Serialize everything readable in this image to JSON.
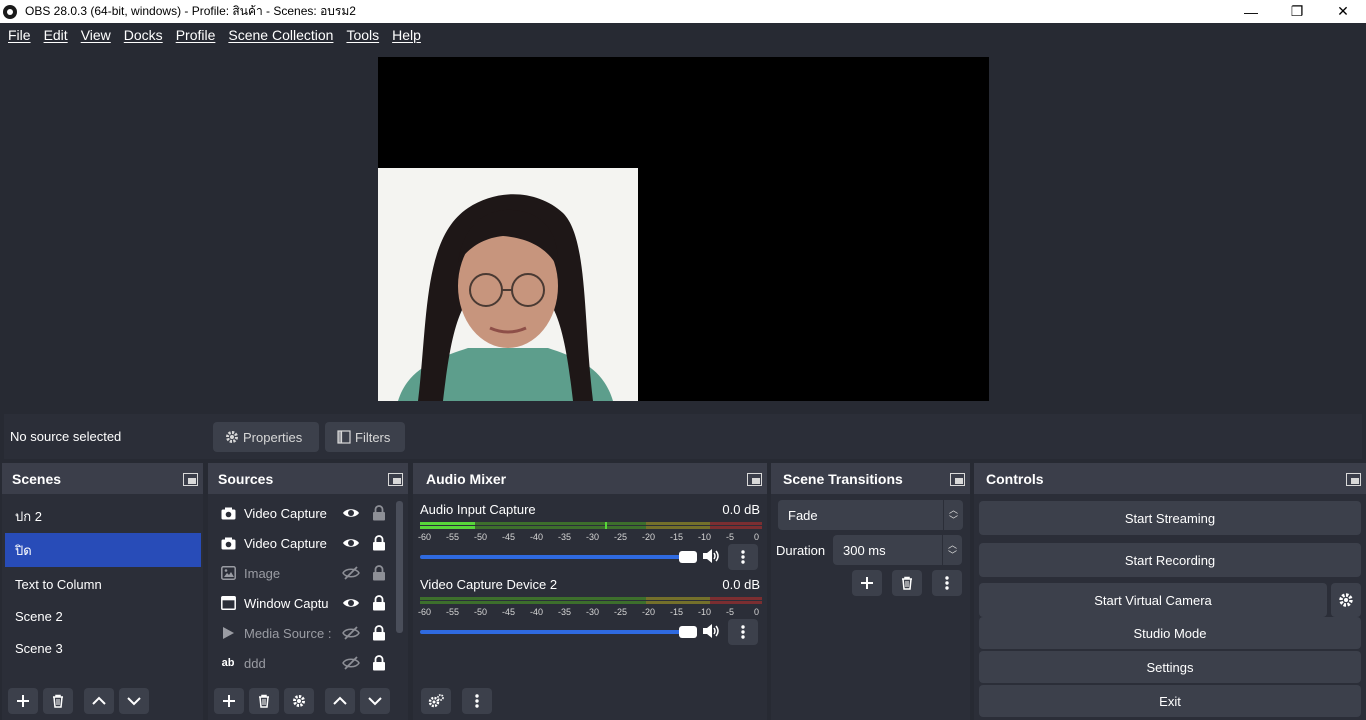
{
  "window": {
    "title": "OBS 28.0.3 (64-bit, windows) - Profile: สินค้า - Scenes: อบรม2",
    "minimize": "—",
    "maximize": "❐",
    "close": "✕"
  },
  "menu": [
    "File",
    "Edit",
    "View",
    "Docks",
    "Profile",
    "Scene Collection",
    "Tools",
    "Help"
  ],
  "source_bar": {
    "no_source": "No source selected",
    "properties": "Properties",
    "filters": "Filters"
  },
  "scenes": {
    "title": "Scenes",
    "items": [
      "ปก 2",
      "ปิด",
      "Text to Column",
      "Scene 2",
      "Scene 3"
    ],
    "selected": "ปิด"
  },
  "sources": {
    "title": "Sources",
    "items": [
      {
        "label": "Video Capture",
        "icon": "camera-icon",
        "visible": true,
        "locked": false
      },
      {
        "label": "Video Capture",
        "icon": "camera-icon",
        "visible": true,
        "locked": true
      },
      {
        "label": "Image",
        "icon": "image-icon",
        "visible": false,
        "locked": false
      },
      {
        "label": "Window Captu",
        "icon": "window-icon",
        "visible": true,
        "locked": true
      },
      {
        "label": "Media Source :",
        "icon": "play-icon",
        "visible": false,
        "locked": true
      },
      {
        "label": "ddd",
        "icon": "text-icon",
        "visible": false,
        "locked": true
      }
    ]
  },
  "audio_mixer": {
    "title": "Audio Mixer",
    "ticks": [
      "-60",
      "-55",
      "-50",
      "-45",
      "-40",
      "-35",
      "-30",
      "-25",
      "-20",
      "-15",
      "-10",
      "-5",
      "0"
    ],
    "channels": [
      {
        "name": "Audio Input Capture",
        "db": "0.0 dB",
        "volume": 1.0
      },
      {
        "name": "Video Capture Device 2",
        "db": "0.0 dB",
        "volume": 1.0
      }
    ]
  },
  "transitions": {
    "title": "Scene Transitions",
    "selected": "Fade",
    "duration_label": "Duration",
    "duration_value": "300 ms"
  },
  "controls": {
    "title": "Controls",
    "start_streaming": "Start Streaming",
    "start_recording": "Start Recording",
    "start_virtual_camera": "Start Virtual Camera",
    "studio_mode": "Studio Mode",
    "settings": "Settings",
    "exit": "Exit"
  },
  "colors": {
    "background": "#272a33",
    "panel": "#2b2e38",
    "dock_title": "#3b3e4a",
    "button": "#3c404b",
    "selection": "#284cb8",
    "slider": "#2f6ae0"
  }
}
